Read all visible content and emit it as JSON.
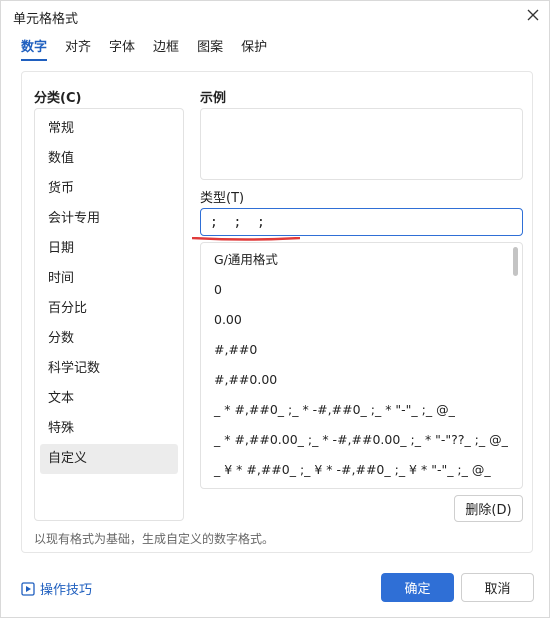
{
  "window": {
    "title": "单元格格式"
  },
  "tabs": [
    {
      "label": "数字",
      "active": true
    },
    {
      "label": "对齐"
    },
    {
      "label": "字体"
    },
    {
      "label": "边框"
    },
    {
      "label": "图案"
    },
    {
      "label": "保护"
    }
  ],
  "category": {
    "label": "分类(C)",
    "items": [
      "常规",
      "数值",
      "货币",
      "会计专用",
      "日期",
      "时间",
      "百分比",
      "分数",
      "科学记数",
      "文本",
      "特殊",
      "自定义"
    ],
    "selected": "自定义"
  },
  "sample": {
    "label": "示例",
    "value": ""
  },
  "type": {
    "label": "类型(T)",
    "value": ";  ;  ;"
  },
  "formats": [
    "G/通用格式",
    "0",
    "0.00",
    "#,##0",
    "#,##0.00",
    "_ * #,##0_ ;_ * -#,##0_ ;_ * \"-\"_ ;_ @_",
    "_ * #,##0.00_ ;_ * -#,##0.00_ ;_ * \"-\"??_ ;_ @_",
    "_ ¥ * #,##0_ ;_ ¥ * -#,##0_ ;_ ¥ * \"-\"_ ;_ @_"
  ],
  "buttons": {
    "delete": "删除(D)",
    "ok": "确定",
    "cancel": "取消"
  },
  "hint": "以现有格式为基础，生成自定义的数字格式。",
  "tips": {
    "label": "操作技巧",
    "icon": "play-box-icon"
  },
  "colors": {
    "accent": "#2f6fd6",
    "underline": "#e03a3a"
  }
}
